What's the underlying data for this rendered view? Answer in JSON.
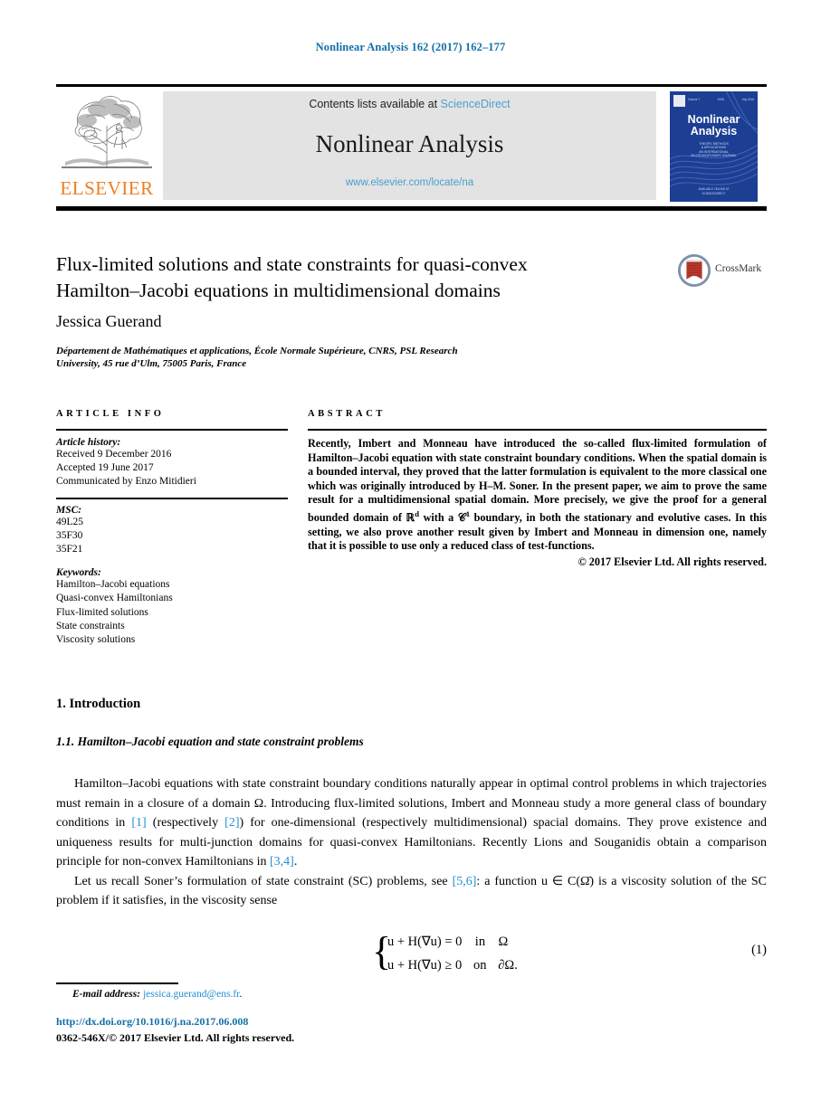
{
  "running_head": "Nonlinear Analysis 162 (2017) 162–177",
  "masthead": {
    "contents_prefix": "Contents lists available at ",
    "sciencedirect": "ScienceDirect",
    "journal_name": "Nonlinear Analysis",
    "journal_url": "www.elsevier.com/locate/na",
    "publisher_wordmark": "ELSEVIER",
    "cover": {
      "title_line1": "Nonlinear",
      "title_line2": "Analysis",
      "subtitle": "THEORY, METHODS\n& APPLICATIONS\nAN INTERNATIONAL\nMULTIDISCIPLINARY JOURNAL",
      "top_left": "Volume 7",
      "top_mid": "ISSN",
      "top_right": "July 2016",
      "foot": "AVAILABLE ONLINE AT\nSCIENCEDIRECT"
    }
  },
  "article": {
    "title_line1": "Flux-limited solutions and state constraints for quasi-convex",
    "title_line2": "Hamilton–Jacobi equations in multidimensional domains",
    "crossmark_label": "CrossMark",
    "author": "Jessica Guerand",
    "affiliation_line1": "Département de Mathématiques et applications, École Normale Supérieure, CNRS, PSL Research",
    "affiliation_line2": "University, 45 rue d’Ulm, 75005 Paris, France"
  },
  "info_column": {
    "heading": "ARTICLE INFO",
    "history_label": "Article history:",
    "history": [
      "Received 9 December 2016",
      "Accepted 19 June 2017",
      "Communicated by Enzo Mitidieri"
    ],
    "msc_label": "MSC:",
    "msc": [
      "49L25",
      "35F30",
      "35F21"
    ],
    "keywords_label": "Keywords:",
    "keywords": [
      "Hamilton–Jacobi equations",
      "Quasi-convex Hamiltonians",
      "Flux-limited solutions",
      "State constraints",
      "Viscosity solutions"
    ]
  },
  "abstract_column": {
    "heading": "ABSTRACT",
    "text_part1": "Recently, Imbert and Monneau have introduced the so-called flux-limited formulation of Hamilton–Jacobi equation with state constraint boundary conditions. When the spatial domain is a bounded interval, they proved that the latter formulation is equivalent to the more classical one which was originally introduced by H–M. Soner. In the present paper, we aim to prove the same result for a multidimensional spatial domain. More precisely, we give the proof for a general bounded domain of ℝ",
    "text_sup1": "d",
    "text_part2": " with a 𝒞",
    "text_sup2": "1",
    "text_part3": " boundary, in both the stationary and evolutive cases. In this setting, we also prove another result given by Imbert and Monneau in dimension one, namely that it is possible to use only a reduced class of test-functions.",
    "copyright": "© 2017 Elsevier Ltd. All rights reserved."
  },
  "body": {
    "section_number_title": "1. Introduction",
    "subsection_number_title": "1.1. Hamilton–Jacobi equation and state constraint problems",
    "para1_a": "Hamilton–Jacobi equations with state constraint boundary conditions naturally appear in optimal control problems in which trajectories must remain in a closure of a domain Ω. Introducing flux-limited solutions, Imbert and Monneau study a more general class of boundary conditions in ",
    "para1_ref1": "[1]",
    "para1_b": " (respectively ",
    "para1_ref2": "[2]",
    "para1_c": ") for one-dimensional (respectively multidimensional) spacial domains. They prove existence and uniqueness results for multi-junction domains for quasi-convex Hamiltonians. Recently Lions and Souganidis obtain a comparison principle for non-convex Hamiltonians in ",
    "para1_ref3": "[3,4]",
    "para1_d": ".",
    "para2_a": "Let us recall Soner’s formulation of state constraint (SC) problems, see ",
    "para2_ref1": "[5,6]",
    "para2_b": ": a function u ∈ C(Ω̄) is a viscosity solution of the SC problem if it satisfies, in the viscosity sense",
    "equation": {
      "line1_lhs": "u + H(∇u) = 0",
      "line1_op": "in",
      "line1_rhs": "Ω",
      "line2_lhs": "u + H(∇u) ≥ 0",
      "line2_op": "on",
      "line2_rhs": "∂Ω.",
      "number": "(1)"
    }
  },
  "footer": {
    "email_label": "E-mail address:",
    "email": "jessica.guerand@ens.fr",
    "email_period": ".",
    "doi": "http://dx.doi.org/10.1016/j.na.2017.06.008",
    "issn_line": "0362-546X/© 2017 Elsevier Ltd. All rights reserved."
  },
  "colors": {
    "link_blue": "#136fa8",
    "ref_blue": "#1f8fd0",
    "sciencedirect_blue": "#4a9fd0",
    "elsevier_orange": "#ee7e23",
    "cover_blue": "#1c3f94"
  }
}
